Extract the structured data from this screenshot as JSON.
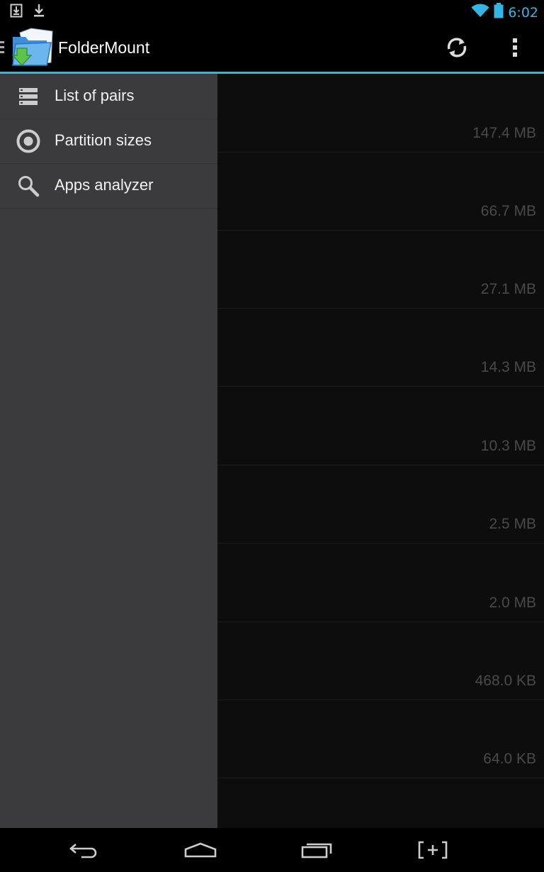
{
  "status_bar": {
    "time": "6:02",
    "left_icons": [
      "sd-download-icon",
      "download-icon"
    ],
    "right_icons": [
      "wifi-icon",
      "battery-icon"
    ]
  },
  "action_bar": {
    "title": "FolderMount",
    "actions": [
      "refresh-icon",
      "overflow-menu-icon"
    ]
  },
  "drawer": {
    "items": [
      {
        "label": "List of pairs",
        "icon": "list-icon"
      },
      {
        "label": "Partition sizes",
        "icon": "partition-icon"
      },
      {
        "label": "Apps analyzer",
        "icon": "search-icon"
      }
    ]
  },
  "content": {
    "sizes": [
      "147.4 MB",
      "66.7 MB",
      "27.1 MB",
      "14.3 MB",
      "10.3 MB",
      "2.5 MB",
      "2.0 MB",
      "468.0 KB",
      "64.0 KB"
    ]
  },
  "nav_bar": {
    "buttons": [
      "back-icon",
      "home-icon",
      "recent-apps-icon",
      "screenshot-icon"
    ]
  },
  "colors": {
    "accent": "#33b5e5",
    "drawer_bg": "#3b3b3d",
    "content_bg": "#0d0d0d"
  }
}
